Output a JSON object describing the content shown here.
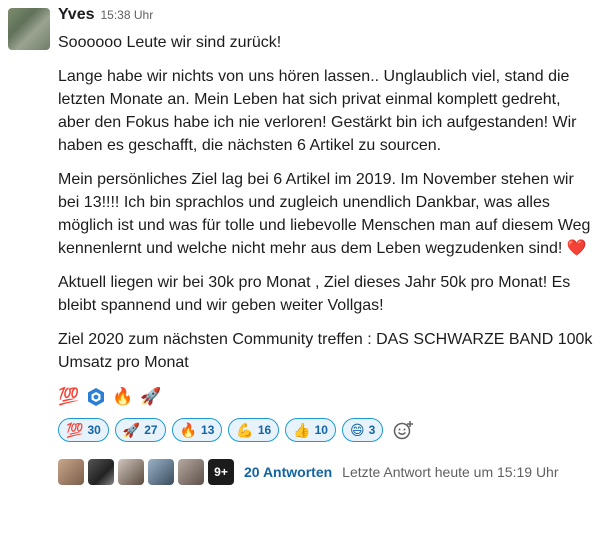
{
  "message": {
    "author": "Yves",
    "time": "15:38 Uhr",
    "paragraphs": [
      "Soooooo Leute wir sind zurück!",
      "Lange habe wir nichts von uns hören lassen.. Unglaublich viel, stand die letzten Monate an. Mein Leben hat sich privat einmal komplett gedreht, aber den Fokus habe ich nie verloren! Gestärkt bin ich aufgestanden! Wir haben es geschafft, die nächsten 6 Artikel zu sourcen.",
      "Mein persönliches Ziel lag bei 6 Artikel im 2019. Im November stehen wir bei 13!!!! Ich bin sprachlos und zugleich unendlich Dankbar, was alles möglich ist und was für tolle und liebevolle Menschen man auf diesem Weg kennenlernt und welche nicht mehr aus dem Leben wegzudenken sind!",
      "Aktuell liegen wir bei 30k pro Monat , Ziel dieses Jahr 50k pro Monat! Es bleibt spannend und wir geben weiter Vollgas!",
      "Ziel 2020 zum nächsten Community treffen : DAS SCHWARZE BAND 100k Umsatz pro Monat"
    ],
    "heart": "❤️",
    "inline_emojis": [
      "💯",
      "blue-hexagon-badge",
      "🔥",
      "🚀"
    ]
  },
  "reactions": [
    {
      "emoji": "💯",
      "count": "30"
    },
    {
      "emoji": "🚀",
      "count": "27"
    },
    {
      "emoji": "🔥",
      "count": "13"
    },
    {
      "emoji": "💪",
      "count": "16"
    },
    {
      "emoji": "👍",
      "count": "10"
    },
    {
      "emoji": "😄",
      "count": "3"
    }
  ],
  "add_reaction_icon": "😀+",
  "thread": {
    "more_count": "9+",
    "replies": "20 Antworten",
    "last_reply": "Letzte Antwort heute um 15:19 Uhr"
  },
  "colors": {
    "link": "#1264a3",
    "pill_bg": "#e8f2fa",
    "pill_border": "#1d9bd1"
  }
}
